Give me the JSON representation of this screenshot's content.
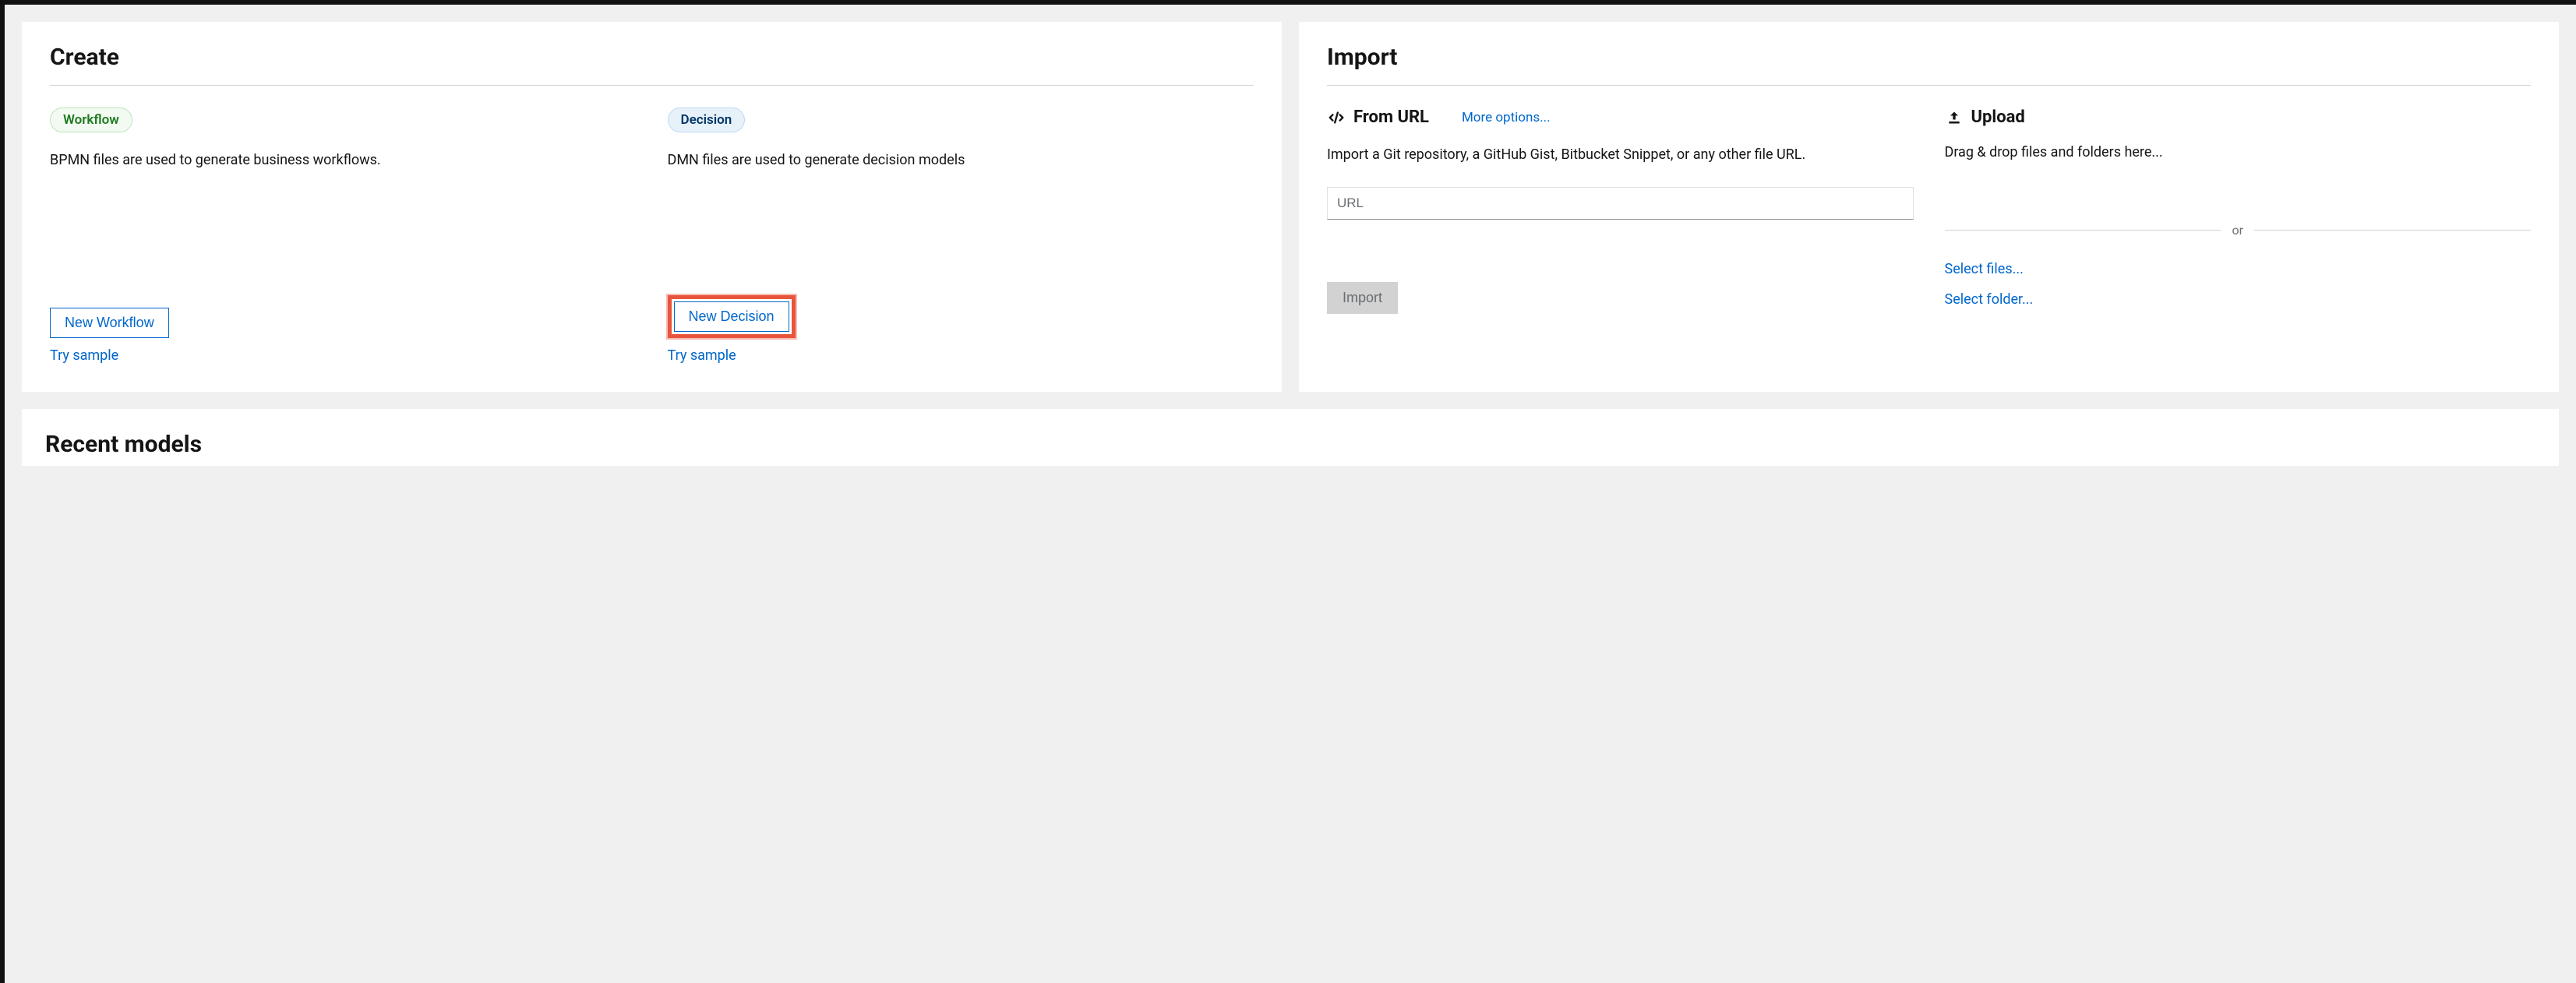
{
  "create": {
    "title": "Create",
    "workflow": {
      "badge": "Workflow",
      "desc": "BPMN files are used to generate business workflows.",
      "newBtn": "New Workflow",
      "trySample": "Try sample"
    },
    "decision": {
      "badge": "Decision",
      "desc": "DMN files are used to generate decision models",
      "newBtn": "New Decision",
      "trySample": "Try sample"
    }
  },
  "import": {
    "title": "Import",
    "fromUrl": {
      "heading": "From URL",
      "moreOptions": "More options...",
      "desc": "Import a Git repository, a GitHub Gist, Bitbucket Snippet, or any other file URL.",
      "placeholder": "URL",
      "importBtn": "Import"
    },
    "upload": {
      "heading": "Upload",
      "desc": "Drag & drop files and folders here...",
      "or": "or",
      "selectFiles": "Select files...",
      "selectFolder": "Select folder..."
    }
  },
  "recent": {
    "title": "Recent models"
  }
}
